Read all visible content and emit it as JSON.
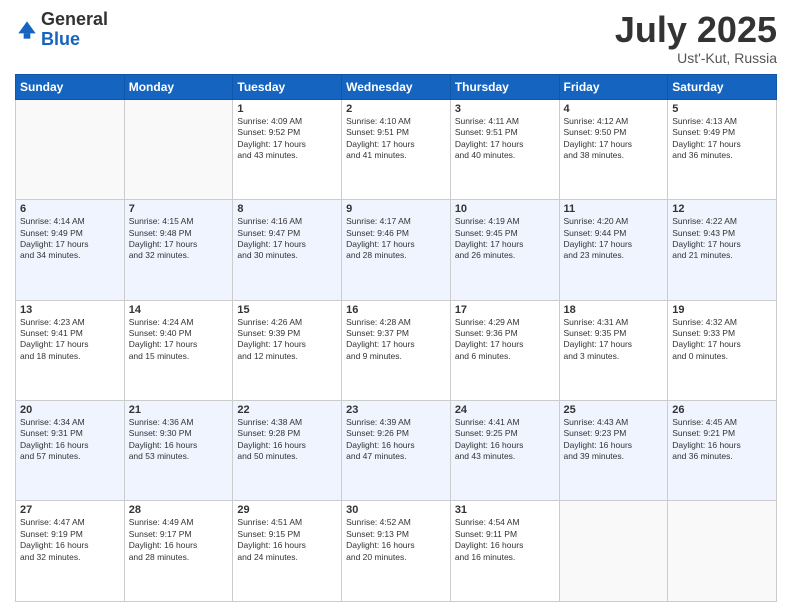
{
  "logo": {
    "general": "General",
    "blue": "Blue"
  },
  "title": {
    "month": "July 2025",
    "location": "Ust'-Kut, Russia"
  },
  "headers": [
    "Sunday",
    "Monday",
    "Tuesday",
    "Wednesday",
    "Thursday",
    "Friday",
    "Saturday"
  ],
  "weeks": [
    [
      {
        "day": "",
        "info": ""
      },
      {
        "day": "",
        "info": ""
      },
      {
        "day": "1",
        "info": "Sunrise: 4:09 AM\nSunset: 9:52 PM\nDaylight: 17 hours\nand 43 minutes."
      },
      {
        "day": "2",
        "info": "Sunrise: 4:10 AM\nSunset: 9:51 PM\nDaylight: 17 hours\nand 41 minutes."
      },
      {
        "day": "3",
        "info": "Sunrise: 4:11 AM\nSunset: 9:51 PM\nDaylight: 17 hours\nand 40 minutes."
      },
      {
        "day": "4",
        "info": "Sunrise: 4:12 AM\nSunset: 9:50 PM\nDaylight: 17 hours\nand 38 minutes."
      },
      {
        "day": "5",
        "info": "Sunrise: 4:13 AM\nSunset: 9:49 PM\nDaylight: 17 hours\nand 36 minutes."
      }
    ],
    [
      {
        "day": "6",
        "info": "Sunrise: 4:14 AM\nSunset: 9:49 PM\nDaylight: 17 hours\nand 34 minutes."
      },
      {
        "day": "7",
        "info": "Sunrise: 4:15 AM\nSunset: 9:48 PM\nDaylight: 17 hours\nand 32 minutes."
      },
      {
        "day": "8",
        "info": "Sunrise: 4:16 AM\nSunset: 9:47 PM\nDaylight: 17 hours\nand 30 minutes."
      },
      {
        "day": "9",
        "info": "Sunrise: 4:17 AM\nSunset: 9:46 PM\nDaylight: 17 hours\nand 28 minutes."
      },
      {
        "day": "10",
        "info": "Sunrise: 4:19 AM\nSunset: 9:45 PM\nDaylight: 17 hours\nand 26 minutes."
      },
      {
        "day": "11",
        "info": "Sunrise: 4:20 AM\nSunset: 9:44 PM\nDaylight: 17 hours\nand 23 minutes."
      },
      {
        "day": "12",
        "info": "Sunrise: 4:22 AM\nSunset: 9:43 PM\nDaylight: 17 hours\nand 21 minutes."
      }
    ],
    [
      {
        "day": "13",
        "info": "Sunrise: 4:23 AM\nSunset: 9:41 PM\nDaylight: 17 hours\nand 18 minutes."
      },
      {
        "day": "14",
        "info": "Sunrise: 4:24 AM\nSunset: 9:40 PM\nDaylight: 17 hours\nand 15 minutes."
      },
      {
        "day": "15",
        "info": "Sunrise: 4:26 AM\nSunset: 9:39 PM\nDaylight: 17 hours\nand 12 minutes."
      },
      {
        "day": "16",
        "info": "Sunrise: 4:28 AM\nSunset: 9:37 PM\nDaylight: 17 hours\nand 9 minutes."
      },
      {
        "day": "17",
        "info": "Sunrise: 4:29 AM\nSunset: 9:36 PM\nDaylight: 17 hours\nand 6 minutes."
      },
      {
        "day": "18",
        "info": "Sunrise: 4:31 AM\nSunset: 9:35 PM\nDaylight: 17 hours\nand 3 minutes."
      },
      {
        "day": "19",
        "info": "Sunrise: 4:32 AM\nSunset: 9:33 PM\nDaylight: 17 hours\nand 0 minutes."
      }
    ],
    [
      {
        "day": "20",
        "info": "Sunrise: 4:34 AM\nSunset: 9:31 PM\nDaylight: 16 hours\nand 57 minutes."
      },
      {
        "day": "21",
        "info": "Sunrise: 4:36 AM\nSunset: 9:30 PM\nDaylight: 16 hours\nand 53 minutes."
      },
      {
        "day": "22",
        "info": "Sunrise: 4:38 AM\nSunset: 9:28 PM\nDaylight: 16 hours\nand 50 minutes."
      },
      {
        "day": "23",
        "info": "Sunrise: 4:39 AM\nSunset: 9:26 PM\nDaylight: 16 hours\nand 47 minutes."
      },
      {
        "day": "24",
        "info": "Sunrise: 4:41 AM\nSunset: 9:25 PM\nDaylight: 16 hours\nand 43 minutes."
      },
      {
        "day": "25",
        "info": "Sunrise: 4:43 AM\nSunset: 9:23 PM\nDaylight: 16 hours\nand 39 minutes."
      },
      {
        "day": "26",
        "info": "Sunrise: 4:45 AM\nSunset: 9:21 PM\nDaylight: 16 hours\nand 36 minutes."
      }
    ],
    [
      {
        "day": "27",
        "info": "Sunrise: 4:47 AM\nSunset: 9:19 PM\nDaylight: 16 hours\nand 32 minutes."
      },
      {
        "day": "28",
        "info": "Sunrise: 4:49 AM\nSunset: 9:17 PM\nDaylight: 16 hours\nand 28 minutes."
      },
      {
        "day": "29",
        "info": "Sunrise: 4:51 AM\nSunset: 9:15 PM\nDaylight: 16 hours\nand 24 minutes."
      },
      {
        "day": "30",
        "info": "Sunrise: 4:52 AM\nSunset: 9:13 PM\nDaylight: 16 hours\nand 20 minutes."
      },
      {
        "day": "31",
        "info": "Sunrise: 4:54 AM\nSunset: 9:11 PM\nDaylight: 16 hours\nand 16 minutes."
      },
      {
        "day": "",
        "info": ""
      },
      {
        "day": "",
        "info": ""
      }
    ]
  ]
}
